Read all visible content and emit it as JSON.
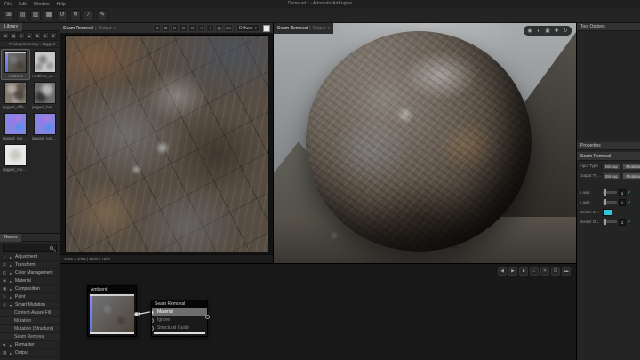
{
  "colors": {
    "accent": "#35c7d8",
    "border_swatch": "#2fc8d9",
    "panel_bg": "#242424"
  },
  "titlebar": {
    "title": "Demo.art * - Artomatix ArtEngine",
    "menus": [
      {
        "label": "File"
      },
      {
        "label": "Edit"
      },
      {
        "label": "Window"
      },
      {
        "label": "Help"
      }
    ]
  },
  "main_toolbar": {
    "icons": [
      {
        "name": "import-assets-icon",
        "glyph": "⊞"
      },
      {
        "name": "open-project-icon",
        "glyph": "▤"
      },
      {
        "name": "add-assets-icon",
        "glyph": "▥"
      },
      {
        "name": "save-project-icon",
        "glyph": "▦"
      },
      {
        "name": "undo-icon",
        "glyph": "↺"
      },
      {
        "name": "redo-icon",
        "glyph": "↻"
      },
      {
        "name": "line-tool-icon",
        "glyph": "⁄"
      },
      {
        "name": "pen-tool-icon",
        "glyph": "✎"
      }
    ]
  },
  "library": {
    "tab": "Library",
    "toolbar_icons": [
      {
        "name": "thumbnail-view-icon",
        "glyph": "⊞"
      },
      {
        "name": "detail-view-icon",
        "glyph": "▤"
      },
      {
        "name": "list-view-icon",
        "glyph": "≡"
      },
      {
        "name": "up-directory-icon",
        "glyph": "▴"
      },
      {
        "name": "sort-icon",
        "glyph": "⇅"
      },
      {
        "name": "refresh-icon",
        "glyph": "↻"
      },
      {
        "name": "add-folder-icon",
        "glyph": "✚"
      }
    ],
    "breadcrumb": {
      "back": "‹",
      "fwd": "›",
      "path": "Photogrammetry › Jagged"
    },
    "items": [
      {
        "label": "Ambient",
        "cls": "tex-stack",
        "selcls": "selected"
      },
      {
        "label": "Ambient_occlu...",
        "cls": "tex-ao",
        "selcls": ""
      },
      {
        "label": "jagged_diffuse.tif",
        "cls": "tex-diffuse",
        "selcls": ""
      },
      {
        "label": "jagged_height.tif",
        "cls": "tex-height",
        "selcls": ""
      },
      {
        "label": "jagged_normal_...",
        "cls": "tex-normal",
        "selcls": ""
      },
      {
        "label": "jagged_normal.tif",
        "cls": "tex-normal",
        "selcls": ""
      },
      {
        "label": "jagged_rough...",
        "cls": "tex-rough",
        "selcls": ""
      }
    ]
  },
  "viewer2d": {
    "tab": "Seam Removal",
    "pipe": "|",
    "sub": "Output",
    "caret": "▾",
    "icons": [
      {
        "name": "fit-view-icon",
        "glyph": "⊡"
      },
      {
        "name": "tiling-icon",
        "glyph": "⊞"
      },
      {
        "name": "channel-r-button",
        "glyph": "R"
      },
      {
        "name": "channel-g-button",
        "glyph": "G"
      },
      {
        "name": "channel-b-button",
        "glyph": "B"
      },
      {
        "name": "channel-a-button",
        "glyph": "A"
      },
      {
        "name": "background-toggle-icon",
        "glyph": "◐"
      },
      {
        "name": "export-icon",
        "glyph": "▤"
      },
      {
        "name": "atx-badge",
        "glyph": "atx"
      }
    ],
    "channel": "Diffuse",
    "status": "4096 x 4096  |  RGBA 16bit"
  },
  "viewer3d": {
    "tab": "Seam Removal",
    "pipe": "|",
    "sub": "Output",
    "caret": "▾",
    "icons": [
      {
        "name": "camera-icon",
        "glyph": "◉"
      },
      {
        "name": "environment-icon",
        "glyph": "◐"
      },
      {
        "name": "mesh-icon",
        "glyph": "▣"
      },
      {
        "name": "light-icon",
        "glyph": "✚"
      },
      {
        "name": "reset-view-icon",
        "glyph": "↻"
      }
    ]
  },
  "tool_options": {
    "tab": "Tool Options"
  },
  "properties": {
    "tab": "Properties",
    "node_title": "Seam Removal",
    "input_type": {
      "label": "Input Type",
      "options": [
        "Bitmap",
        "Mutation"
      ],
      "selected": "Bitmap"
    },
    "output_type": {
      "label": "Output Type",
      "options": [
        "Bitmap",
        "Mutation"
      ],
      "selected": "Bitmap"
    },
    "x_axis": {
      "label": "x axis",
      "value": "1"
    },
    "y_axis": {
      "label": "y axis",
      "value": "1"
    },
    "border_color": {
      "label": "Border Color",
      "swatch": "#2fc8d9"
    },
    "border_opacity": {
      "label": "Border Opa...",
      "value": "1"
    },
    "check_glyph": "✓"
  },
  "nodes_panel": {
    "tab": "Nodes",
    "search_value": "",
    "items": [
      {
        "glyph": "◑",
        "arrow": "▸",
        "label": "Adjustment",
        "cls": "top"
      },
      {
        "glyph": "⇄",
        "arrow": "▸",
        "label": "Transform",
        "cls": "top"
      },
      {
        "glyph": "◧",
        "arrow": "▸",
        "label": "Color Management",
        "cls": "top"
      },
      {
        "glyph": "◉",
        "arrow": "▸",
        "label": "Material",
        "cls": "top"
      },
      {
        "glyph": "▣",
        "arrow": "▸",
        "label": "Composition",
        "cls": "top"
      },
      {
        "glyph": "✎",
        "arrow": "▸",
        "label": "Paint",
        "cls": "top"
      },
      {
        "glyph": "◎",
        "arrow": "▾",
        "label": "Smart Mutation",
        "cls": "top"
      },
      {
        "glyph": "",
        "arrow": "",
        "label": "Content-Aware Fill",
        "cls": "child"
      },
      {
        "glyph": "",
        "arrow": "",
        "label": "Mutation",
        "cls": "child"
      },
      {
        "glyph": "",
        "arrow": "",
        "label": "Mutation (Structure)",
        "cls": "child"
      },
      {
        "glyph": "",
        "arrow": "",
        "label": "Seam Removal",
        "cls": "child"
      },
      {
        "glyph": "◆",
        "arrow": "▸",
        "label": "Remaster",
        "cls": "top"
      },
      {
        "glyph": "▦",
        "arrow": "▸",
        "label": "Output",
        "cls": "top"
      }
    ]
  },
  "graph": {
    "toolbar_icons": [
      {
        "name": "nav-back-icon",
        "glyph": "◀"
      },
      {
        "name": "nav-forward-icon",
        "glyph": "▶"
      },
      {
        "name": "stop-icon",
        "glyph": "■"
      },
      {
        "name": "home-icon",
        "glyph": "⌂"
      },
      {
        "name": "close-icon",
        "glyph": "✕"
      },
      {
        "name": "fit-graph-icon",
        "glyph": "⊡"
      },
      {
        "name": "collapse-icon",
        "glyph": "▬"
      }
    ],
    "ambient": {
      "title": "Ambient"
    },
    "seam": {
      "title": "Seam Removal",
      "inputs": [
        {
          "label": "Material",
          "cls": "active"
        },
        {
          "label": "Ignore",
          "cls": "dim"
        },
        {
          "label": "Structural Guide",
          "cls": "dim"
        }
      ]
    }
  }
}
